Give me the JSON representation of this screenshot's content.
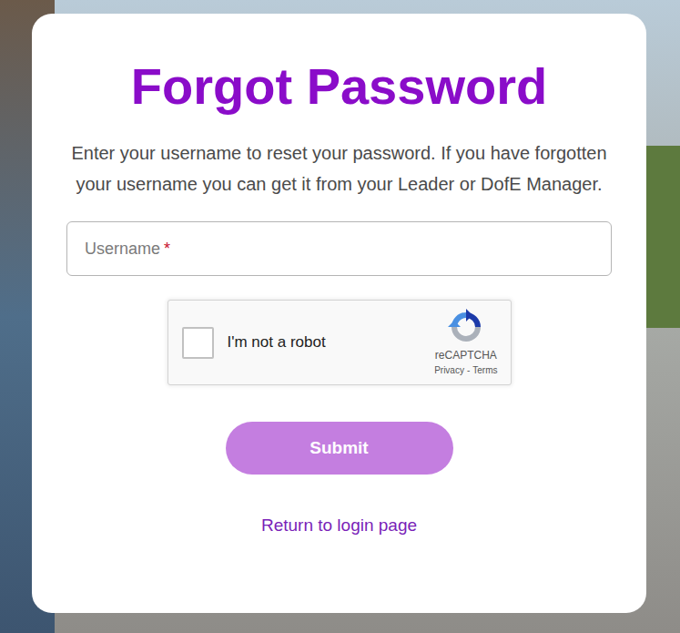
{
  "page": {
    "title": "Forgot Password",
    "instructions": "Enter your username to reset your password. If you have forgotten your username you can get it from your Leader or DofE Manager."
  },
  "username_field": {
    "placeholder": "Username",
    "required_mark": "*",
    "value": ""
  },
  "captcha": {
    "label": "I'm not a robot",
    "brand": "reCAPTCHA",
    "links": [
      "Privacy",
      "Terms"
    ],
    "separator": "-",
    "checked": false
  },
  "submit_button": {
    "label": "Submit",
    "disabled": true
  },
  "login_link": {
    "label": "Return to login page"
  }
}
